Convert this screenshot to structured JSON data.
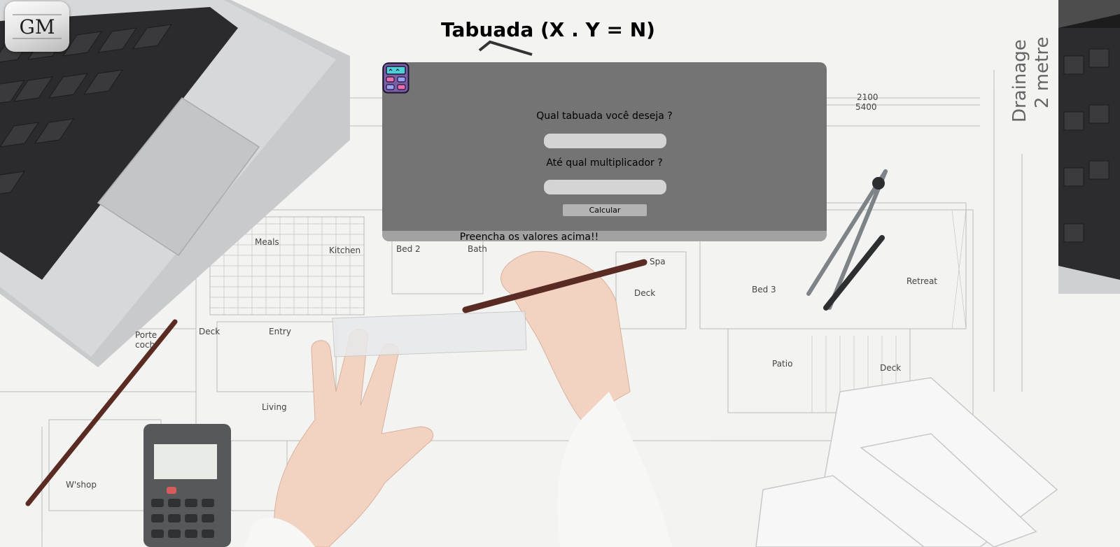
{
  "page": {
    "title": "Tabuada (X . Y = N)"
  },
  "logo": {
    "text": "GM"
  },
  "form": {
    "table_question": "Qual tabuada você deseja ?",
    "table_input_value": "",
    "multiplier_question": "Até qual multiplicador ?",
    "multiplier_input_value": "",
    "calculate_label": "Calcular"
  },
  "result": {
    "message": "Preencha os valores acima!!"
  },
  "icons": {
    "logo": "gm-logo-icon",
    "calculator": "calculator-icon"
  },
  "colors": {
    "panel": "#747474",
    "input": "#d4d4d4",
    "button": "#b3b3b3",
    "result_bar": "#a2a2a2",
    "calculator_icon_body": "#7b5ea8",
    "calculator_icon_screen": "#4fd0d8",
    "calculator_icon_keys": "#ec6fb0"
  }
}
